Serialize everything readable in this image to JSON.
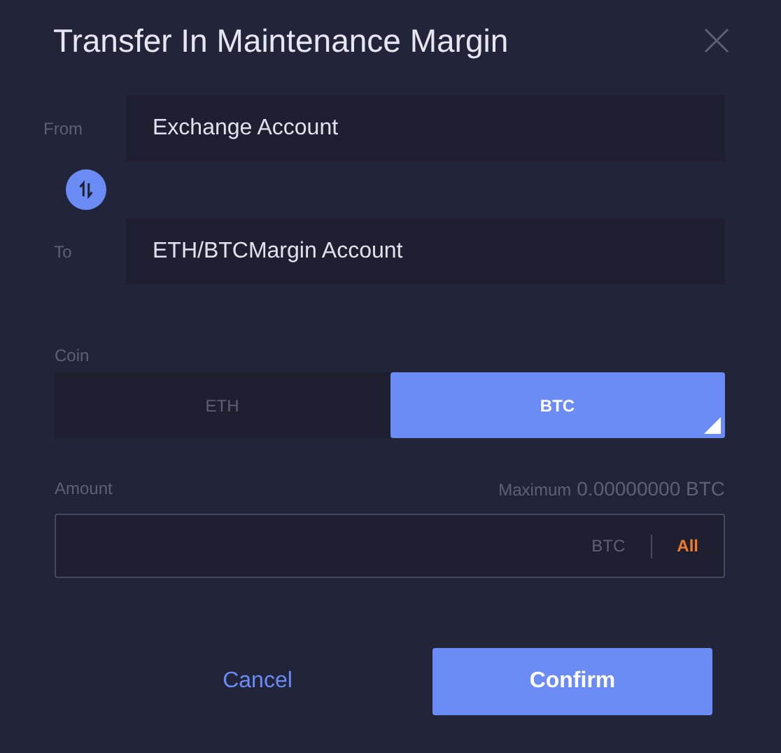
{
  "dialog": {
    "title": "Transfer In Maintenance Margin"
  },
  "from": {
    "label": "From",
    "value": "Exchange Account"
  },
  "to": {
    "label": "To",
    "value": "ETH/BTCMargin Account"
  },
  "coin": {
    "label": "Coin",
    "options": [
      {
        "label": "ETH",
        "selected": false
      },
      {
        "label": "BTC",
        "selected": true
      }
    ]
  },
  "amount": {
    "label": "Amount",
    "maximum_label": "Maximum",
    "maximum_value": "0.00000000 BTC",
    "unit": "BTC",
    "all_button": "All"
  },
  "buttons": {
    "cancel": "Cancel",
    "confirm": "Confirm"
  }
}
